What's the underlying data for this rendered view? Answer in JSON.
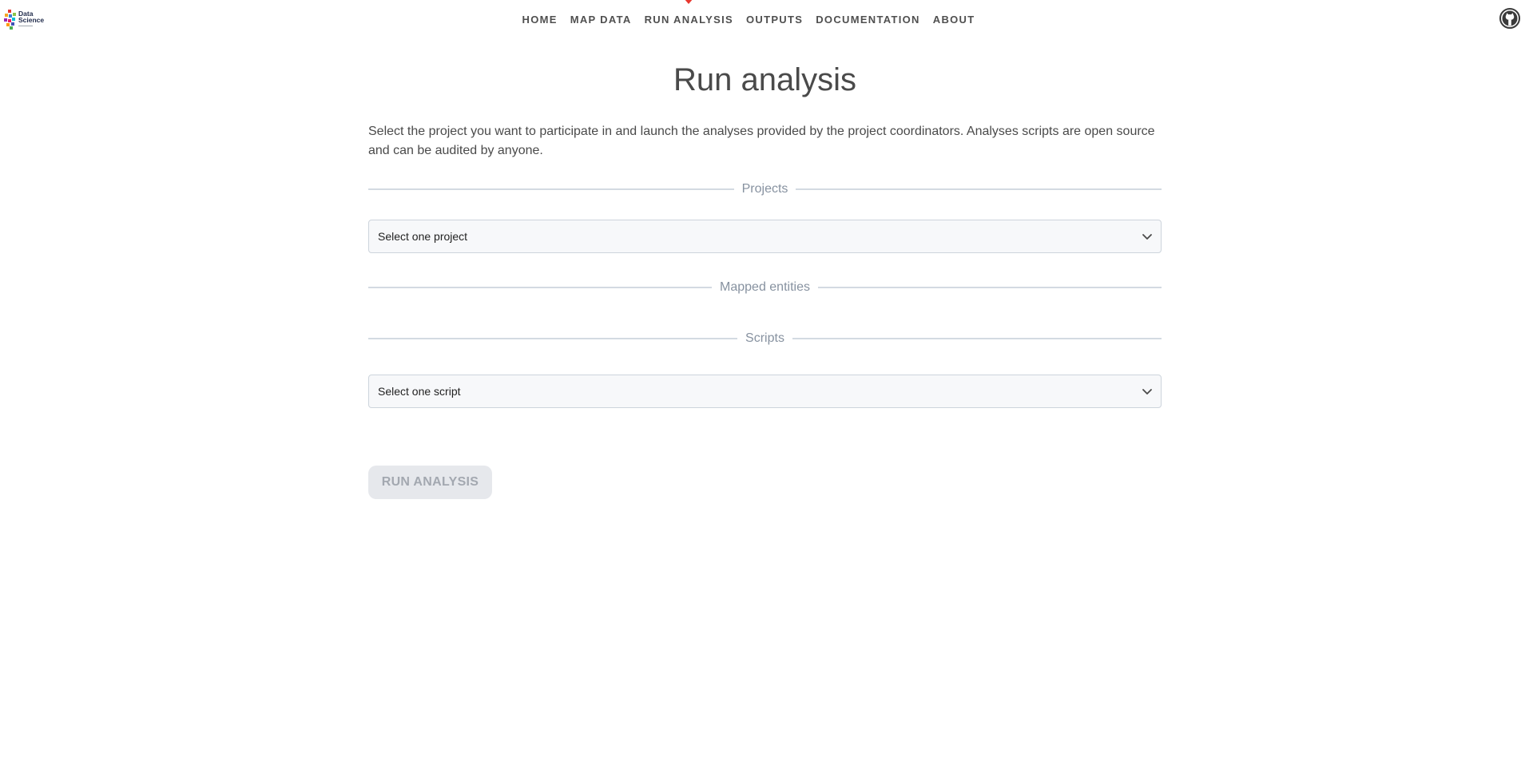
{
  "brand": {
    "logo_line1": "Data",
    "logo_line2": "Science"
  },
  "nav": {
    "items": [
      {
        "label": "HOME"
      },
      {
        "label": "MAP DATA"
      },
      {
        "label": "RUN ANALYSIS",
        "active": true
      },
      {
        "label": "OUTPUTS"
      },
      {
        "label": "DOCUMENTATION"
      },
      {
        "label": "ABOUT"
      }
    ],
    "accent": "#e8382f"
  },
  "header_right": {
    "icon": "github-icon"
  },
  "page": {
    "title": "Run analysis",
    "intro": "Select the project you want to participate in and launch the analyses provided by the project coordinators. Analyses scripts are open source and can be audited by anyone."
  },
  "sections": {
    "projects": {
      "label": "Projects",
      "select_value": "Select one project"
    },
    "mapped_entities": {
      "label": "Mapped entities"
    },
    "scripts": {
      "label": "Scripts",
      "select_value": "Select one script"
    }
  },
  "actions": {
    "run_label": "RUN ANALYSIS",
    "run_disabled": true
  }
}
